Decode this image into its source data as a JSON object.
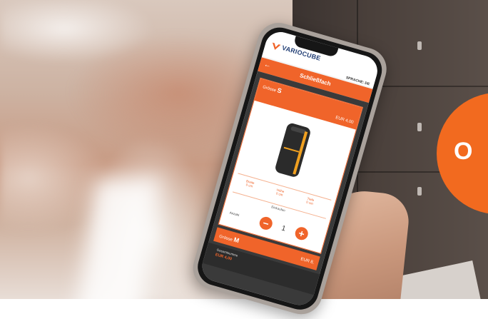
{
  "brand": {
    "name": "VARIOCUBE",
    "accent_color": "#f0642a",
    "logo_color": "#1f3c73"
  },
  "app": {
    "language_label": "SPRACHE: DE",
    "back_icon": "arrow-left-icon",
    "title": "Schließfach"
  },
  "selected_locker": {
    "size_label": "Grösse",
    "size_value": "S",
    "price": "EUR 4,00",
    "image_icon": "locker-bag-icon",
    "dimensions": [
      {
        "label": "Breite",
        "value": "0 cm"
      },
      {
        "label": "Höhe",
        "value": "0 cm"
      },
      {
        "label": "Tiefe",
        "value": "0 cm"
      }
    ],
    "add_to_cart_label": "Einkaufen",
    "quantity_label": "Anzahl",
    "quantity_value": "1",
    "minus_icon": "minus-icon",
    "plus_icon": "plus-icon"
  },
  "next_locker": {
    "size_label": "Grösse",
    "size_value": "M",
    "price": "EUR 8,"
  },
  "footer": {
    "total_label": "Gesamtsumme",
    "total_value": "EUR 4,00"
  },
  "overlay_badge": {
    "text": "O",
    "color": "#f26a1f"
  }
}
